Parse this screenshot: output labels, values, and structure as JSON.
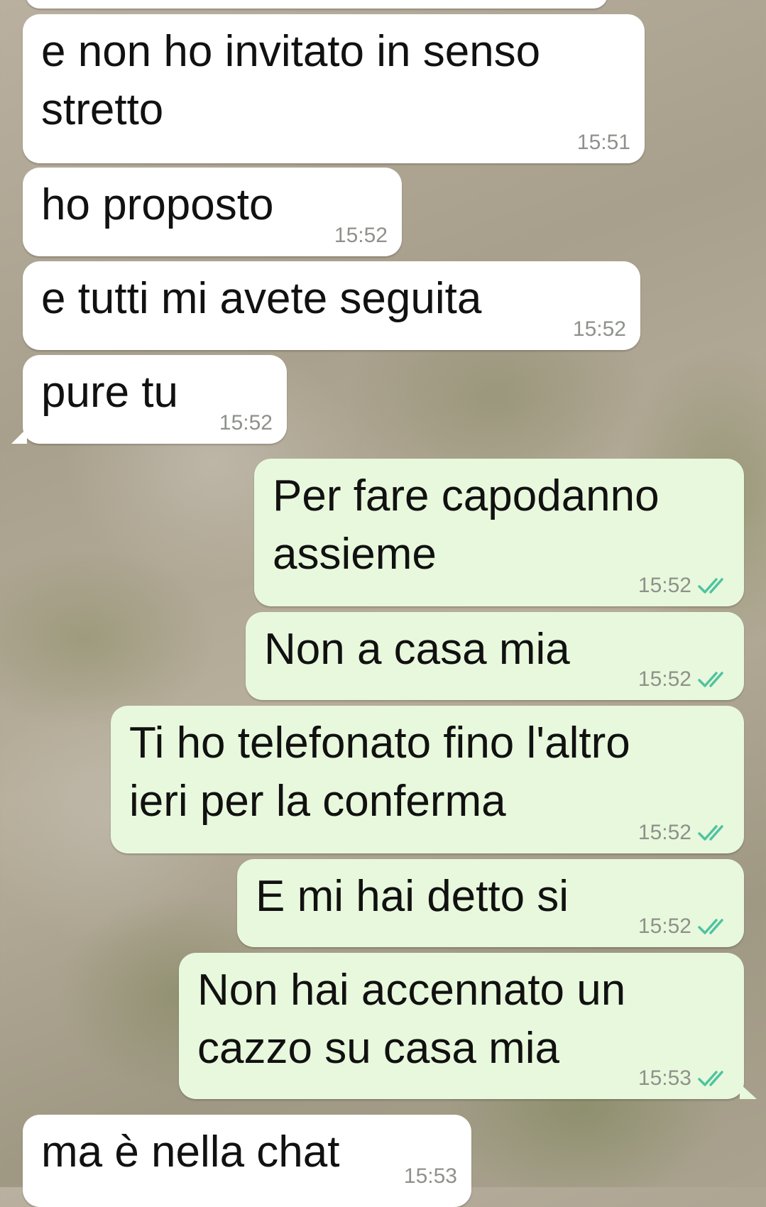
{
  "chat": {
    "messages": [
      {
        "direction": "in",
        "text": "e non ho invitato in senso\nstretto",
        "time": "15:51"
      },
      {
        "direction": "in",
        "text": "ho proposto",
        "time": "15:52"
      },
      {
        "direction": "in",
        "text": "e tutti mi avete seguita",
        "time": "15:52"
      },
      {
        "direction": "in",
        "text": "pure tu",
        "time": "15:52"
      },
      {
        "direction": "out",
        "text": "Per fare capodanno\nassieme",
        "time": "15:52",
        "status_icon": "double-check-icon"
      },
      {
        "direction": "out",
        "text": "Non a casa mia",
        "time": "15:52",
        "status_icon": "double-check-icon"
      },
      {
        "direction": "out",
        "text": "Ti ho telefonato fino l'altro\nieri per la conferma",
        "time": "15:52",
        "status_icon": "double-check-icon"
      },
      {
        "direction": "out",
        "text": "E mi hai detto si",
        "time": "15:52",
        "status_icon": "double-check-icon"
      },
      {
        "direction": "out",
        "text": "Non hai accennato un\ncazzo su casa mia",
        "time": "15:53",
        "status_icon": "double-check-icon"
      },
      {
        "direction": "in",
        "text": "ma è nella chat",
        "time": "15:53"
      }
    ]
  },
  "colors": {
    "incoming_bubble": "#ffffff",
    "outgoing_bubble": "#e8f8dc",
    "read_tick": "#4fc3a1",
    "timestamp": "#8e918c"
  }
}
